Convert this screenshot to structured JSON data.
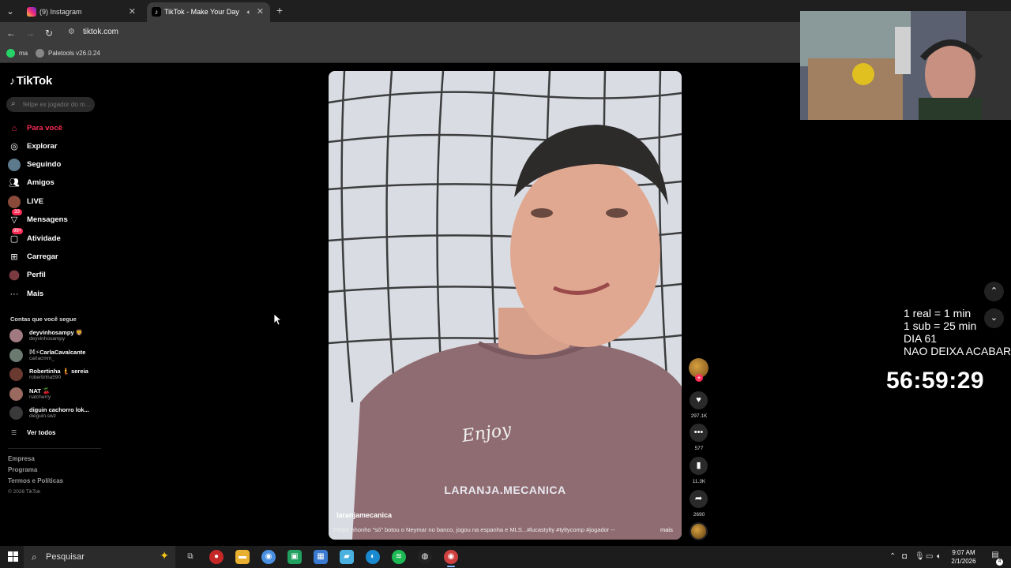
{
  "browser": {
    "tabs": [
      {
        "title": "(9) Instagram",
        "icon": "instagram-icon",
        "active": false
      },
      {
        "title": "TikTok - Make Your Day",
        "icon": "tiktok-icon",
        "active": true
      }
    ],
    "url": "tiktok.com",
    "bookmarks": [
      {
        "label": "ma",
        "icon": "whatsapp-icon"
      },
      {
        "label": "Paletools v26.0.24",
        "icon": "paletools-icon"
      }
    ]
  },
  "sidebar": {
    "logo": "TikTok",
    "search_placeholder": "felipe ex jogador do m...",
    "nav": [
      {
        "label": "Para você",
        "icon": "home-icon",
        "active": true
      },
      {
        "label": "Explorar",
        "icon": "compass-icon"
      },
      {
        "label": "Seguindo",
        "icon": "following-avatar-icon"
      },
      {
        "label": "Amigos",
        "icon": "friends-icon"
      },
      {
        "label": "LIVE",
        "icon": "live-icon"
      },
      {
        "label": "Mensagens",
        "icon": "messages-icon",
        "badge": "33"
      },
      {
        "label": "Atividade",
        "icon": "activity-icon",
        "badge": "99+"
      },
      {
        "label": "Carregar",
        "icon": "upload-icon"
      },
      {
        "label": "Perfil",
        "icon": "profile-icon"
      },
      {
        "label": "Mais",
        "icon": "more-icon"
      }
    ],
    "following_title": "Contas que você segue",
    "accounts": [
      {
        "name": "deyvinhosampy 🦁",
        "handle": "deyvinhosampy"
      },
      {
        "name": "𝕄⚡CarlaCavalcante",
        "handle": "carlacmm_"
      },
      {
        "name": "Robertinha 🧜 sereia",
        "handle": "robertinha590"
      },
      {
        "name": "NAT 🍒",
        "handle": "natcherry"
      },
      {
        "name": "diguin cachorro lok...",
        "handle": "dieguin.swz"
      }
    ],
    "see_all": "Ver todos",
    "footer_links": [
      "Empresa",
      "Programa",
      "Termos e Políticas"
    ],
    "copyright": "© 2026 TikTok"
  },
  "video": {
    "overlay_text": "LARANJA.MECANICA",
    "shirt_text": "Enjoy",
    "author": "laranjamecanica",
    "caption": "Felipe nhonho \"só\" botou o Neymar no banco, jogou na espanha e MLS...#lucastylty #tyltycomp #jogador --",
    "more": "mais",
    "likes": "297.1K",
    "comments": "577",
    "saves": "11.3K",
    "shares": "2690"
  },
  "stream": {
    "lines": [
      "1 real = 1 min",
      "1 sub = 25 min",
      "DIA 61",
      "NAO DEIXA ACABAR"
    ],
    "timer": "56:59:29"
  },
  "taskbar": {
    "search_label": "Pesquisar",
    "time": "9:07 AM",
    "date": "2/1/2026",
    "notifications": "4"
  },
  "colors": {
    "accent": "#fe2c55",
    "background": "#000000",
    "chrome": "#3c3c3c"
  }
}
